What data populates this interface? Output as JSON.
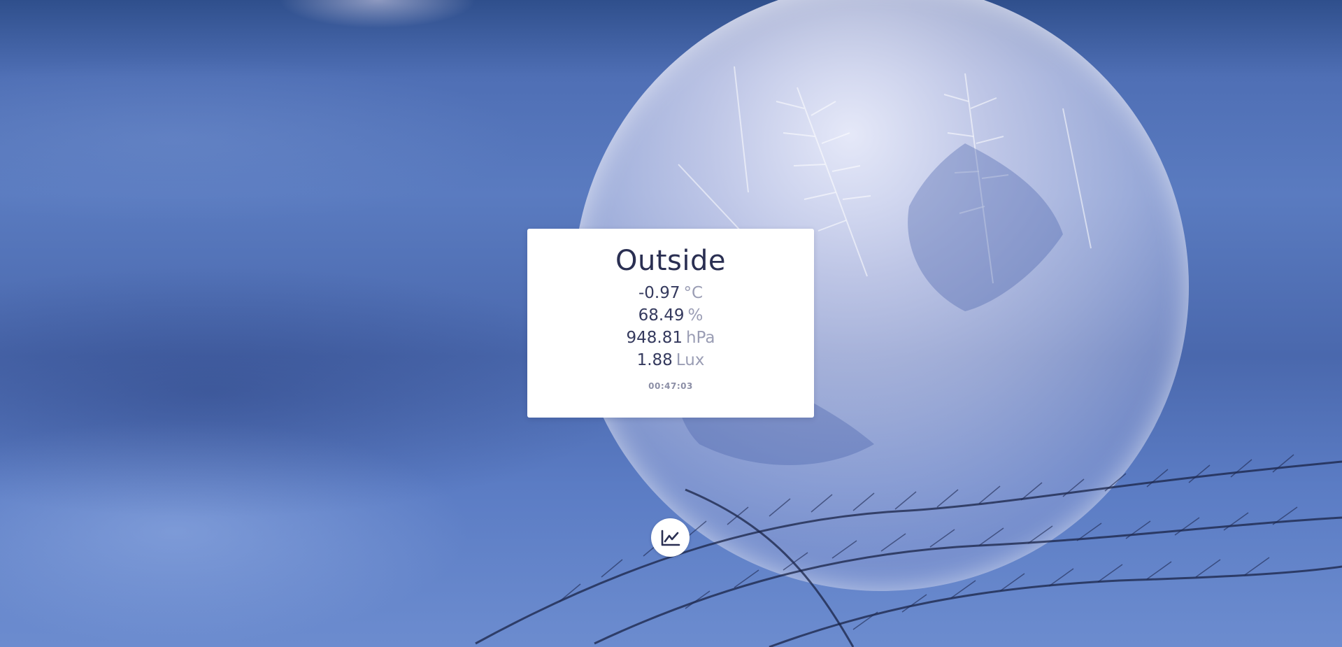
{
  "card": {
    "title": "Outside",
    "readings": [
      {
        "value": "-0.97",
        "unit": "°C"
      },
      {
        "value": "68.49",
        "unit": "%"
      },
      {
        "value": "948.81",
        "unit": "hPa"
      },
      {
        "value": "1.88",
        "unit": "Lux"
      }
    ],
    "time": "00:47:03"
  },
  "chart_button": {
    "icon": "line-chart-icon"
  },
  "colors": {
    "card_background": "#ffffff",
    "text_primary": "#2a2f52",
    "unit_text": "#9a9db4",
    "time_text": "#8c8fa6"
  }
}
